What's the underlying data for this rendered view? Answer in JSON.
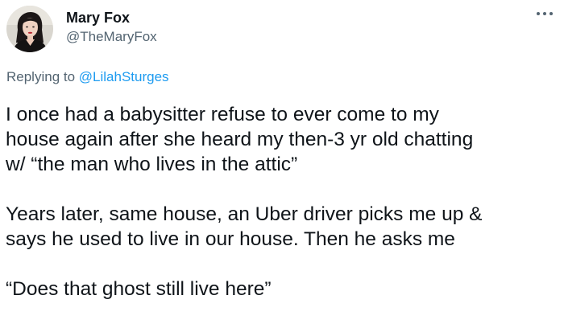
{
  "author": {
    "display_name": "Mary Fox",
    "handle": "@TheMaryFox",
    "avatar_icon": "profile-photo"
  },
  "menu": {
    "more_icon": "more-horizontal-icon"
  },
  "reply": {
    "prefix": "Replying to ",
    "to_handle": "@LilahSturges"
  },
  "tweet": {
    "lines": [
      "I once had a babysitter refuse to ever come to my",
      "house again after she heard my then-3 yr old chatting",
      "w/ “the man who lives in the attic”",
      "",
      "Years later, same house, an Uber driver picks me up &",
      "says he used to live in our house. Then he asks me",
      "",
      "“Does that ghost still live here”"
    ]
  },
  "colors": {
    "text_primary": "#0f1419",
    "text_secondary": "#536471",
    "link": "#1d9bf0"
  }
}
